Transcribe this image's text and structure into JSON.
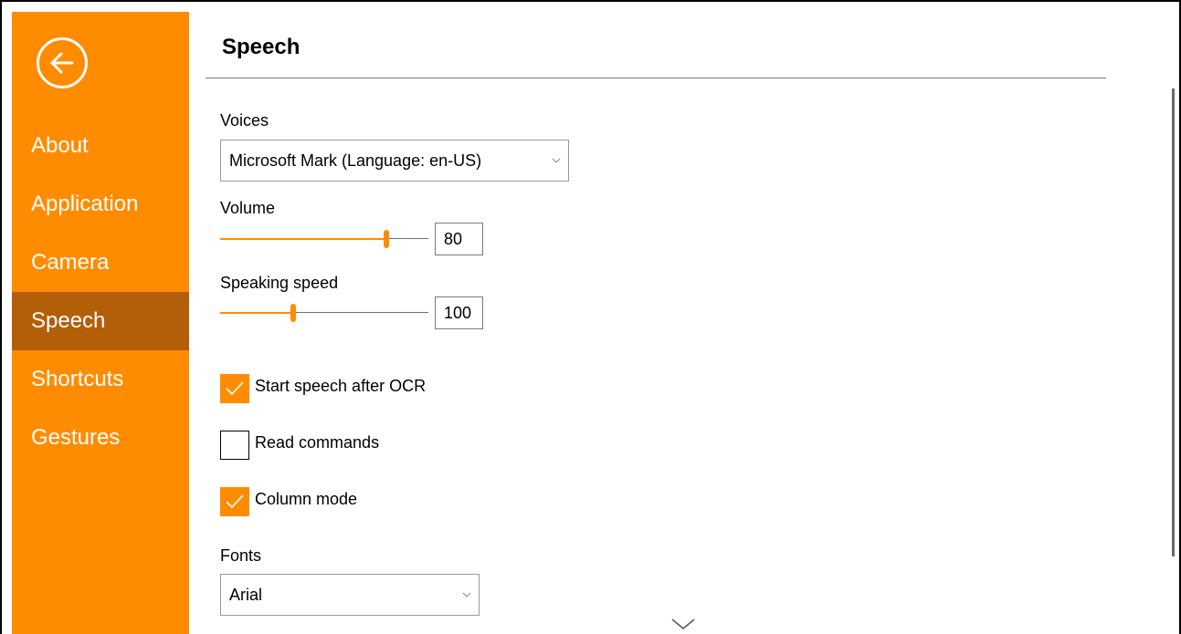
{
  "colors": {
    "accent": "#ff8c00",
    "accent_dark": "#b35f0a",
    "text": "#000000",
    "background": "#ffffff"
  },
  "sidebar": {
    "back_icon": "arrow-left-circle-icon",
    "items": [
      {
        "label": "About",
        "active": false
      },
      {
        "label": "Application",
        "active": false
      },
      {
        "label": "Camera",
        "active": false
      },
      {
        "label": "Speech",
        "active": true
      },
      {
        "label": "Shortcuts",
        "active": false
      },
      {
        "label": "Gestures",
        "active": false
      }
    ]
  },
  "page": {
    "title": "Speech",
    "voices": {
      "label": "Voices",
      "selected": "Microsoft Mark (Language: en-US)"
    },
    "volume": {
      "label": "Volume",
      "value": "80",
      "level": 0.8
    },
    "speaking_speed": {
      "label": "Speaking speed",
      "value": "100",
      "level": 0.35
    },
    "options": [
      {
        "label": "Start speech after OCR",
        "checked": true
      },
      {
        "label": "Read commands",
        "checked": false
      },
      {
        "label": "Column mode",
        "checked": true
      }
    ],
    "fonts": {
      "label": "Fonts",
      "selected": "Arial"
    },
    "scroll_more_icon": "chevron-down-icon"
  }
}
